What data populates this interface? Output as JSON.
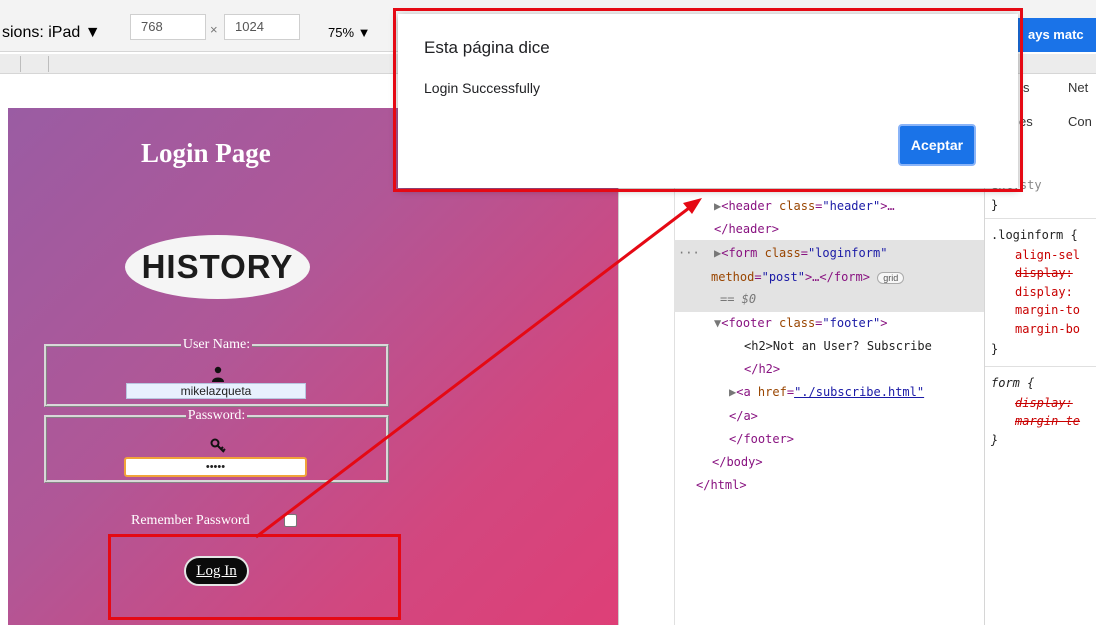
{
  "toolbar": {
    "dimensions_label": "sions: iPad ▼",
    "width_value": "768",
    "times_symbol": "×",
    "height_value": "1024",
    "zoom_label": "75% ▼",
    "devtools_button_label": "ays matc"
  },
  "page": {
    "title": "Login Page",
    "logo_text": "HISTORY",
    "username_legend": "User Name:",
    "username_value": "mikelazqueta",
    "password_legend": "Password:",
    "password_value": "•••••",
    "remember_label": "Remember Password",
    "login_button": "Log In"
  },
  "devtools": {
    "tabs": [
      "s",
      "Net",
      "es",
      "Con"
    ],
    "filter_letter": "r",
    "elements": [
      "</header>",
      "</h2>",
      "</a>",
      "</footer>",
      "</body>",
      "</html>"
    ],
    "header_tag": "<header",
    "header_attr": "class",
    "header_val": "\"header\"",
    "header_end": ">…",
    "form_tag": "<form",
    "form_attr1": "class",
    "form_val1": "\"loginform\"",
    "form_attr2": "method",
    "form_val2": "\"post\"",
    "form_end": ">…</form>",
    "grid_badge": "grid",
    "selected_ref": "== $0",
    "footer_tag": "<footer",
    "footer_attr": "class",
    "footer_val": "\"footer\"",
    "footer_end": ">",
    "h2_text": "<h2>Not an User? Subscribe",
    "a_tag": "<a",
    "a_attr": "href",
    "a_val": "\"./subscribe.html\"",
    "dots": "···",
    "styles": {
      "element_style": "ent.sty",
      "close1": "}",
      "loginform_selector": ".loginform {",
      "align": "align-sel",
      "display_struck": "display:",
      "display": "display:",
      "margin_top": "margin-to",
      "margin_bottom": "margin-bo",
      "close2": "}",
      "form_selector": "form {",
      "form_display": "display:",
      "form_margin": "margin-te",
      "close3": "}"
    }
  },
  "dialog": {
    "title": "Esta página dice",
    "message": "Login Successfully",
    "accept_button": "Aceptar"
  },
  "annotation_color": "#e50914"
}
